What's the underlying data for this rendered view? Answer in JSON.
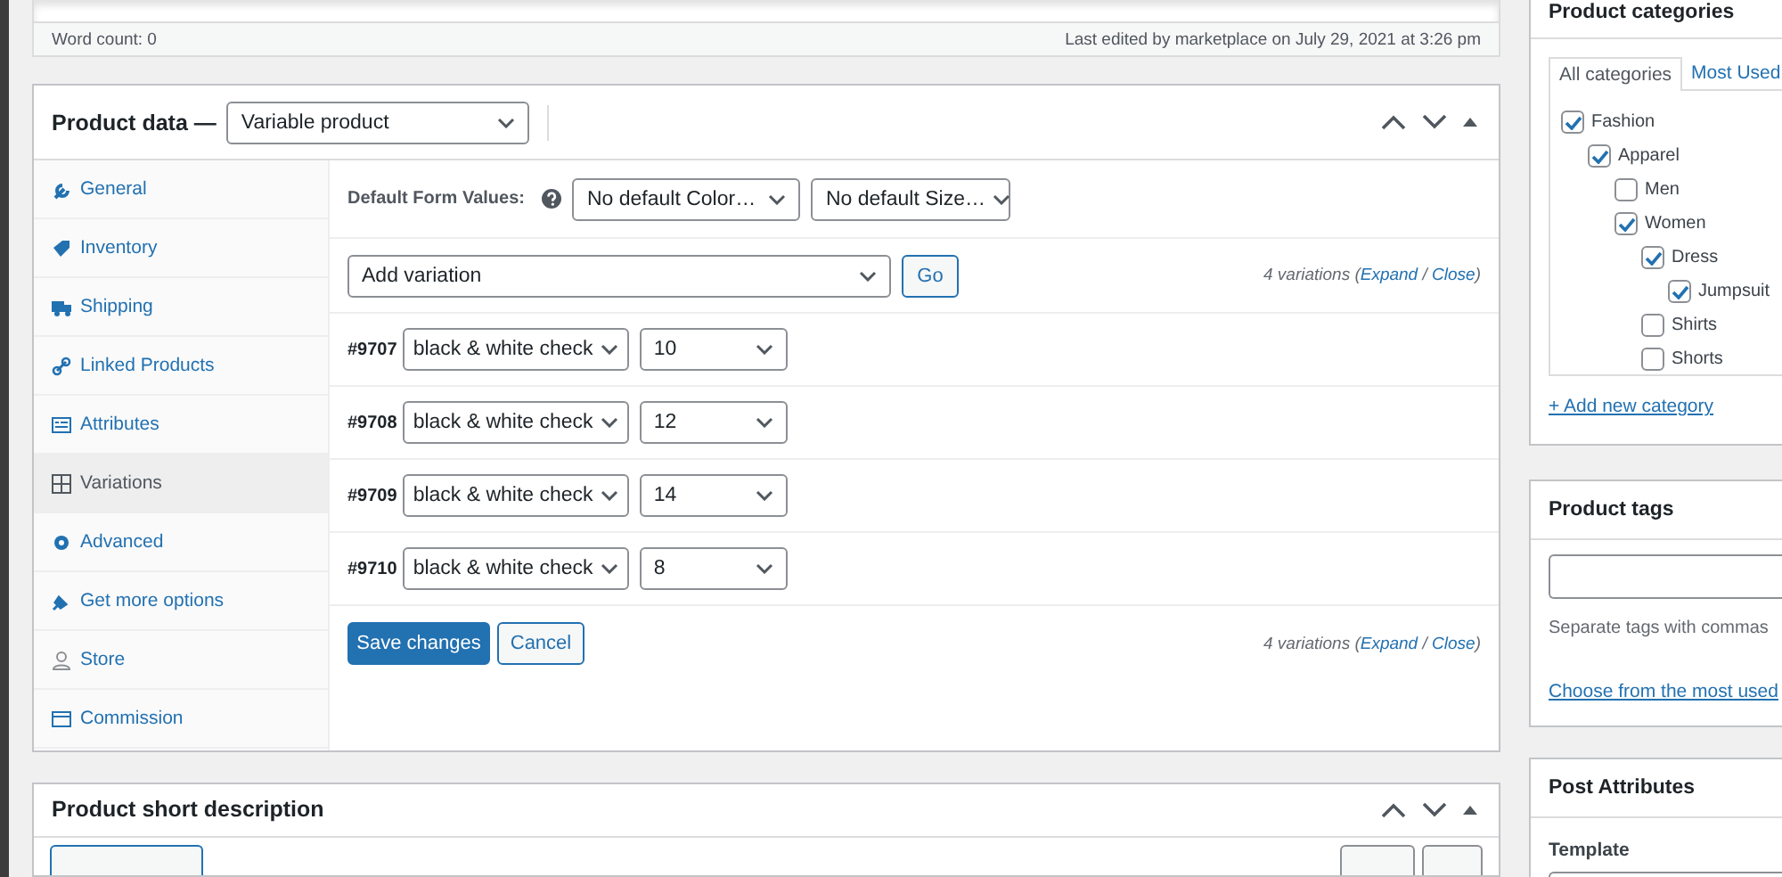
{
  "editor_status": {
    "word_count": "Word count: 0",
    "last_edited": "Last edited by marketplace on July 29, 2021 at 3:26 pm"
  },
  "product_data": {
    "title": "Product data —",
    "product_type": "Variable product",
    "tabs": [
      {
        "label": "General",
        "selected": false
      },
      {
        "label": "Inventory",
        "selected": false
      },
      {
        "label": "Shipping",
        "selected": false
      },
      {
        "label": "Linked Products",
        "selected": false
      },
      {
        "label": "Attributes",
        "selected": false
      },
      {
        "label": "Variations",
        "selected": true
      },
      {
        "label": "Advanced",
        "selected": false
      },
      {
        "label": "Get more options",
        "selected": false
      },
      {
        "label": "Store",
        "selected": false
      },
      {
        "label": "Commission",
        "selected": false
      }
    ],
    "default_form": {
      "label": "Default Form Values:",
      "selects": [
        "No default Color…",
        "No default Size…"
      ]
    },
    "add_variation": {
      "value": "Add variation",
      "button": "Go",
      "summary": [
        {
          "kind": "plain",
          "text": "4 variations ("
        },
        {
          "kind": "link",
          "text": "Expand"
        },
        {
          "kind": "plain",
          "text": " / "
        },
        {
          "kind": "link",
          "text": "Close"
        },
        {
          "kind": "plain",
          "text": ")"
        }
      ]
    },
    "variations": [
      {
        "id": "#9707",
        "pattern_option": "black & white check",
        "size_option": "10"
      },
      {
        "id": "#9708",
        "pattern_option": "black & white check",
        "size_option": "12"
      },
      {
        "id": "#9709",
        "pattern_option": "black & white check",
        "size_option": "14"
      },
      {
        "id": "#9710",
        "pattern_option": "black & white check",
        "size_option": "8"
      }
    ],
    "buttons": [
      {
        "label": "Save changes",
        "kind": "primary"
      },
      {
        "label": "Cancel",
        "kind": "secondary"
      }
    ],
    "footer_summary": [
      {
        "kind": "plain",
        "text": "4 variations ("
      },
      {
        "kind": "link",
        "text": "Expand"
      },
      {
        "kind": "plain",
        "text": " / "
      },
      {
        "kind": "link",
        "text": "Close"
      },
      {
        "kind": "plain",
        "text": ")"
      }
    ]
  },
  "short_description": {
    "title": "Product short description"
  },
  "categories": {
    "title": "Product categories",
    "tabs": [
      {
        "label": "All categories",
        "selected": true
      },
      {
        "label": "Most Used",
        "selected": false
      }
    ],
    "items": [
      {
        "label": "Fashion",
        "checked": true,
        "children": [
          {
            "label": "Apparel",
            "checked": true,
            "children": [
              {
                "label": "Men",
                "checked": false
              },
              {
                "label": "Women",
                "checked": true,
                "children": [
                  {
                    "label": "Dress",
                    "checked": true,
                    "children": [
                      {
                        "label": "Jumpsuit",
                        "checked": true
                      }
                    ]
                  },
                  {
                    "label": "Shirts",
                    "checked": false
                  },
                  {
                    "label": "Shorts",
                    "checked": false
                  }
                ]
              }
            ]
          }
        ]
      }
    ],
    "add_link": "+ Add new category"
  },
  "tags": {
    "title": "Product tags",
    "hint": "Separate tags with commas",
    "link": "Choose from the most used"
  },
  "post_attributes": {
    "title": "Post Attributes",
    "template_label": "Template"
  }
}
